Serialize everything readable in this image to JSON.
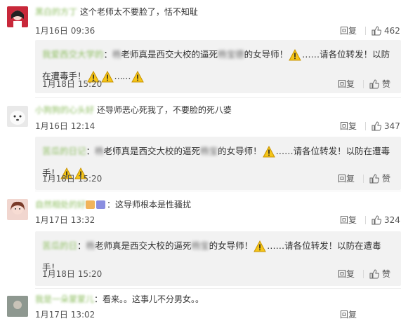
{
  "icons": {
    "warning": "warning-triangle-icon",
    "thumb": "thumbs-up-icon"
  },
  "comments": [
    {
      "user": "黑白的方丁",
      "text": "这个老师太不要脸了，恬不知耻",
      "time": "1月16日 09:36",
      "reply": "回复",
      "likes": "462",
      "quote": {
        "user": "我爱西交大学的",
        "prefix": "：",
        "blur_name": "杨",
        "part1": "老师真是西交大校的逼死",
        "blur_mid": "杨宝德",
        "part2": "的女导师！",
        "part3": "……请各位转发！以防在遭毒手！",
        "dots": "……",
        "time": "1月18日 15:20",
        "reply": "回复",
        "like": "赞"
      }
    },
    {
      "user": "小狗狗的心头好",
      "text": "还导师恶心死我了，不要脸的死八婆",
      "time": "1月16日 12:14",
      "reply": "回复",
      "likes": "347",
      "quote": {
        "user": "苦瓜的日记",
        "prefix": "：",
        "blur_name": "杨",
        "part1": "老师真是西交大校的逼死",
        "blur_mid": "杨宝",
        "part2": "的女导师！",
        "part3": "……请各位转发！以防在遭毒手！",
        "time": "1月18日 15:20",
        "reply": "回复",
        "like": "赞"
      }
    },
    {
      "user": "自然相处的好",
      "text": "：这导师根本是性骚扰",
      "time": "1月17日 13:32",
      "reply": "回复",
      "likes": "324",
      "quote": {
        "user": "苦瓜的日",
        "prefix": "：",
        "blur_name": "杨",
        "part1": "老师真是西交大校的逼死",
        "blur_mid": "杨宝",
        "part2": "的女导师！",
        "part3": "……请各位转发！以防在遭毒手！",
        "time": "1月18日 15:20",
        "reply": "回复",
        "like": "赞"
      }
    },
    {
      "user": "我是一朵蒙蒙儿",
      "text": "：看来。。这事儿不分男女。。",
      "time": "1月17日 13:02",
      "reply": "回复",
      "likes": ""
    }
  ]
}
